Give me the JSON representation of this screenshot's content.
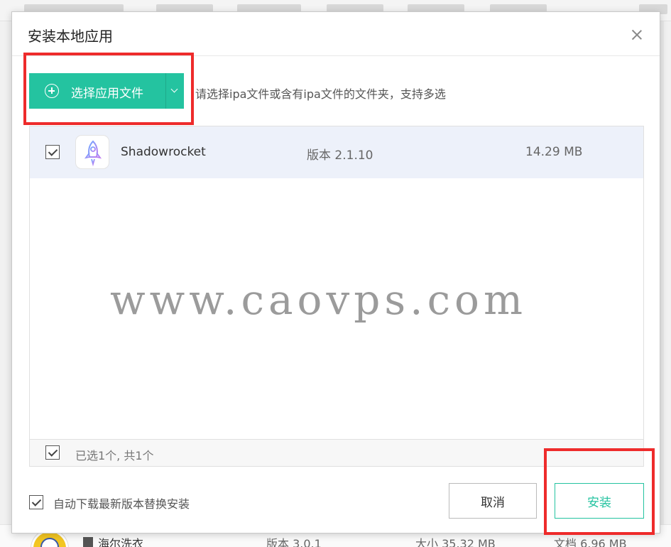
{
  "dialog": {
    "title": "安装本地应用",
    "close_icon": "close-icon"
  },
  "toolbar": {
    "select_label": "选择应用文件",
    "select_icon": "plus-circle-icon",
    "dropdown_icon": "chevron-down-icon",
    "hint": "请选择ipa文件或含有ipa文件的文件夹，支持多选"
  },
  "apps": [
    {
      "name": "Shadowrocket",
      "version": "版本 2.1.10",
      "size": "14.29 MB",
      "checked": true,
      "icon": "rocket-icon"
    }
  ],
  "list_footer": {
    "count_text": "已选1个, 共1个",
    "checked": true
  },
  "options": {
    "auto_update_label": "自动下载最新版本替换安装",
    "checked": true
  },
  "buttons": {
    "cancel": "取消",
    "install": "安装"
  },
  "watermark": "www.caovps.com",
  "background_row": {
    "name": "海尔洗衣",
    "version": "版本 3.0.1",
    "size": "大小 35.32 MB",
    "docs": "文档 6.96 MB"
  },
  "colors": {
    "accent": "#24c3a0",
    "highlight": "#ee2b2b",
    "row_selected": "#edf1fa"
  }
}
